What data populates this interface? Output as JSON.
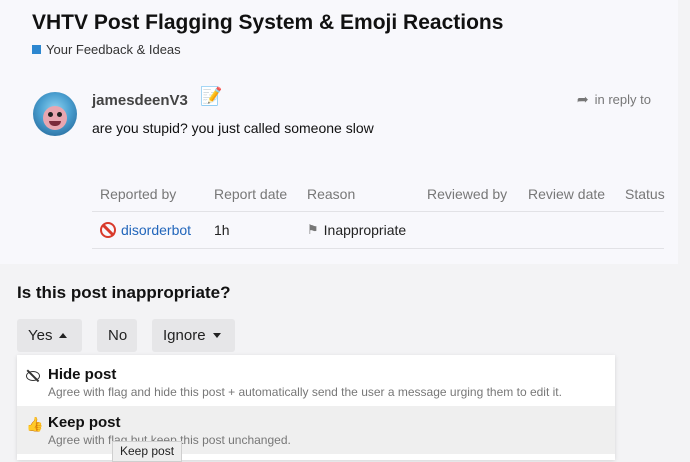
{
  "topic": {
    "title": "VHTV Post Flagging System & Emoji Reactions",
    "category": "Your Feedback & Ideas",
    "category_color": "#2d87d0"
  },
  "post": {
    "username": "jamesdeenV3",
    "user_icon": "memo-icon",
    "reply_label": "in reply to",
    "body": "are you stupid? you just called someone slow"
  },
  "flags_table": {
    "headers": [
      "Reported by",
      "Report date",
      "Reason",
      "Reviewed by",
      "Review date",
      "Status"
    ],
    "rows": [
      {
        "reported_by": "disorderbot",
        "report_date": "1h",
        "reason": "Inappropriate",
        "reviewed_by": "",
        "review_date": "",
        "status": ""
      }
    ]
  },
  "review": {
    "question": "Is this post inappropriate?",
    "yes_label": "Yes",
    "no_label": "No",
    "ignore_label": "Ignore"
  },
  "menu": {
    "items": [
      {
        "label": "Hide post",
        "description": "Agree with flag and hide this post + automatically send the user a message urging them to edit it.",
        "icon": "eye-slash-icon"
      },
      {
        "label": "Keep post",
        "description": "Agree with flag but keep this post unchanged.",
        "icon": "thumbs-up-icon"
      }
    ],
    "tooltip": "Keep post"
  }
}
